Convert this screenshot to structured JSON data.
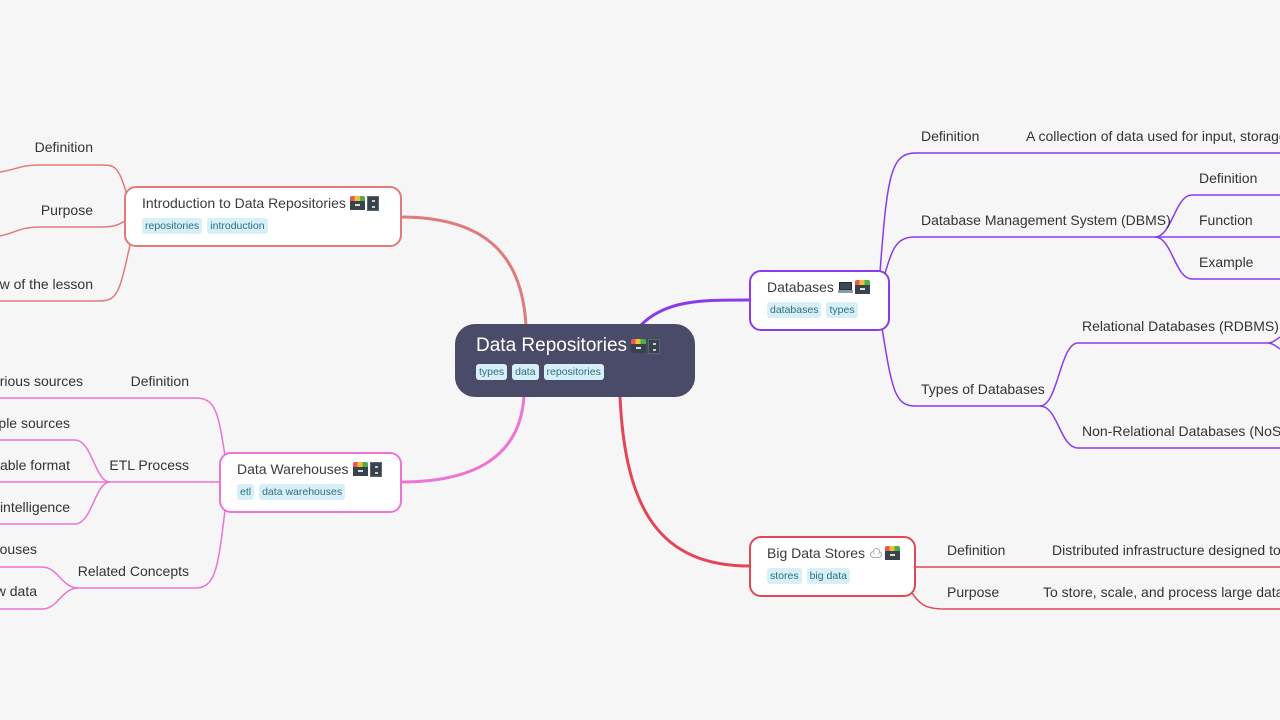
{
  "colors": {
    "background": "#f6f6f6",
    "root_fill": "#4a4b68",
    "intro": "#e07b7b",
    "databases": "#8a3ce8",
    "warehouses": "#ec74d2",
    "bigdata": "#e24756",
    "tag_bg": "#d7eff7",
    "tag_text": "#2f6f86"
  },
  "root": {
    "title": "Data Repositories",
    "icons": [
      "card-file-box-icon",
      "file-cabinet-icon"
    ],
    "tags": [
      "types",
      "data",
      "repositories"
    ]
  },
  "intro": {
    "title": "Introduction to Data Repositories",
    "icons": [
      "card-file-box-icon",
      "file-cabinet-icon"
    ],
    "tags": [
      "repositories",
      "introduction"
    ],
    "children": [
      "Definition",
      "Purpose",
      "ew of the lesson"
    ]
  },
  "warehouses": {
    "title": "Data Warehouses",
    "icons": [
      "card-file-box-icon",
      "file-cabinet-icon"
    ],
    "tags": [
      "etl",
      "data warehouses"
    ],
    "children": [
      {
        "label": "Definition",
        "leaves": [
          "arious sources"
        ]
      },
      {
        "label": "ETL Process",
        "leaves": [
          "iple sources",
          "able format",
          "intelligence"
        ]
      },
      {
        "label": "Related Concepts",
        "leaves": [
          "houses",
          "w data"
        ]
      }
    ]
  },
  "databases": {
    "title": "Databases",
    "icons": [
      "laptop-icon",
      "card-file-box-icon"
    ],
    "tags": [
      "databases",
      "types"
    ],
    "children": [
      {
        "label": "Definition",
        "leaves": [
          "A collection of data used for input, storage,"
        ]
      },
      {
        "label": "Database Management System (DBMS)",
        "leaves": [
          "Definition",
          "Function",
          "Example"
        ]
      },
      {
        "label": "Types of Databases",
        "leaves": [
          "Relational Databases (RDBMS)",
          "Non-Relational Databases (NoSQ"
        ]
      }
    ]
  },
  "bigdata": {
    "title": "Big Data Stores",
    "icons": [
      "cloud-icon",
      "card-file-box-icon"
    ],
    "tags": [
      "stores",
      "big data"
    ],
    "children": [
      {
        "label": "Definition",
        "leaves": [
          "Distributed infrastructure designed to"
        ]
      },
      {
        "label": "Purpose",
        "leaves": [
          "To store, scale, and process large data se"
        ]
      }
    ]
  }
}
